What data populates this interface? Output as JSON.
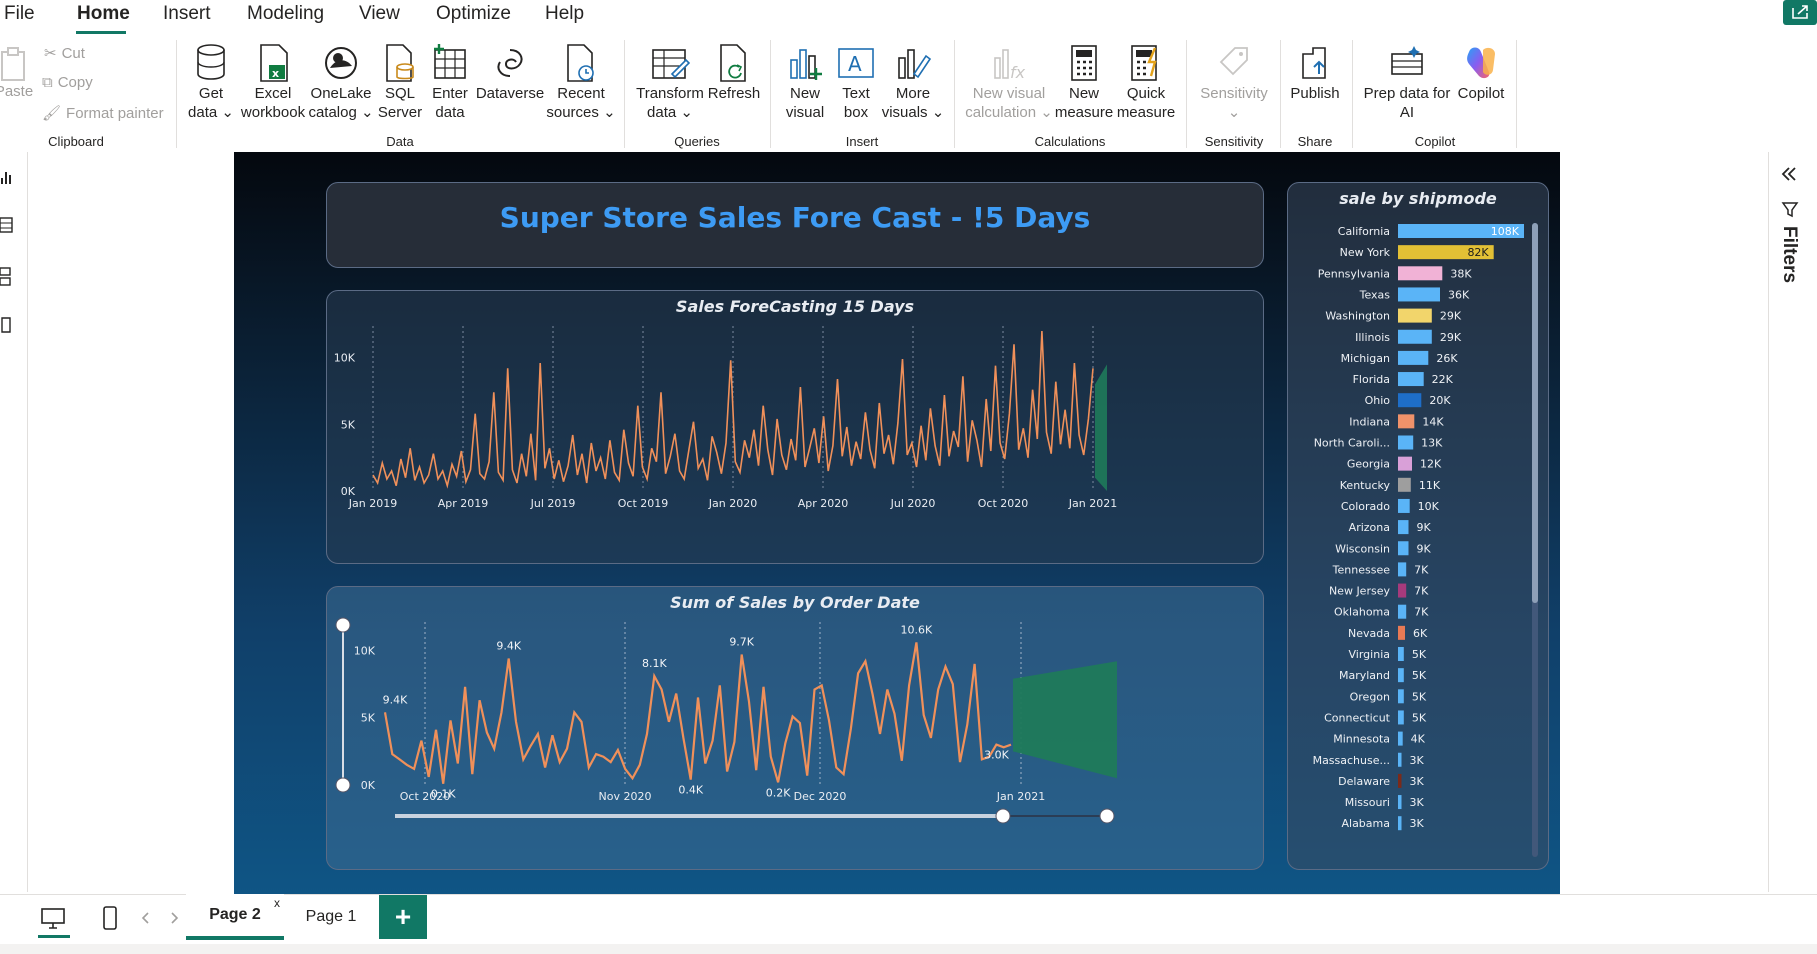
{
  "menu": [
    "File",
    "Home",
    "Insert",
    "Modeling",
    "View",
    "Optimize",
    "Help"
  ],
  "ribbon": {
    "clipboard": {
      "paste": "Paste",
      "cut": "Cut",
      "copy": "Copy",
      "format_painter": "Format painter",
      "label": "Clipboard"
    },
    "data": {
      "label": "Data",
      "buttons": [
        {
          "l1": "Get",
          "l2": "data ⌄"
        },
        {
          "l1": "Excel",
          "l2": "workbook"
        },
        {
          "l1": "OneLake",
          "l2": "catalog ⌄"
        },
        {
          "l1": "SQL",
          "l2": "Server"
        },
        {
          "l1": "Enter",
          "l2": "data"
        },
        {
          "l1": "Dataverse",
          "l2": ""
        },
        {
          "l1": "Recent",
          "l2": "sources ⌄"
        }
      ]
    },
    "queries": {
      "label": "Queries",
      "transform_l1": "Transform",
      "transform_l2": "data ⌄",
      "refresh": "Refresh"
    },
    "insert": {
      "label": "Insert",
      "new_visual_l1": "New",
      "new_visual_l2": "visual",
      "text_box_l1": "Text",
      "text_box_l2": "box",
      "more_visuals_l1": "More",
      "more_visuals_l2": "visuals ⌄"
    },
    "calculations": {
      "label": "Calculations",
      "new_visual_calc_l1": "New visual",
      "new_visual_calc_l2": "calculation ⌄",
      "new_measure_l1": "New",
      "new_measure_l2": "measure",
      "quick_measure_l1": "Quick",
      "quick_measure_l2": "measure"
    },
    "sensitivity": {
      "label": "Sensitivity",
      "button": "Sensitivity",
      "chevron": "⌄"
    },
    "share": {
      "label": "Share",
      "publish": "Publish"
    },
    "copilot": {
      "label": "Copilot",
      "prep_l1": "Prep data for",
      "prep_l2": "AI",
      "copilot": "Copilot"
    }
  },
  "report": {
    "title": "Super Store Sales Fore Cast - !5 Days",
    "forecast_title": "Sales ForeCasting 15 Days",
    "orders_title": "Sum of Sales by Order Date",
    "ship_title": "sale by shipmode"
  },
  "chart_data": [
    {
      "type": "line",
      "title": "Sales ForeCasting 15 Days",
      "x_ticks": [
        "Jan 2019",
        "Apr 2019",
        "Jul 2019",
        "Oct 2019",
        "Jan 2020",
        "Apr 2020",
        "Jul 2020",
        "Oct 2020",
        "Jan 2021"
      ],
      "y_ticks": [
        "0K",
        "5K",
        "10K"
      ],
      "ylim": [
        0,
        12000
      ],
      "series": [
        {
          "values": [
            1200,
            600,
            2100,
            900,
            1500,
            400,
            2400,
            1000,
            3200,
            800,
            1800,
            600,
            1200,
            2800,
            900,
            1500,
            400,
            2000,
            1100,
            3000,
            700,
            1600,
            5800,
            1300,
            900,
            2200,
            7400,
            1400,
            800,
            9200,
            1600,
            600,
            2800,
            1100,
            4300,
            800,
            9600,
            1700,
            3200,
            900,
            2300,
            700,
            1900,
            4200,
            1200,
            2800,
            600,
            3600,
            1500,
            2500,
            900,
            3800,
            1400,
            800,
            4600,
            2100,
            1100,
            6400,
            1800,
            900,
            3200,
            2200,
            7400,
            1300,
            2600,
            4300,
            1500,
            900,
            3100,
            5200,
            1700,
            2400,
            800,
            4100,
            2900,
            1300,
            3600,
            9800,
            2200,
            1400,
            3800,
            2500,
            4600,
            1900,
            6400,
            3100,
            1200,
            5400,
            2700,
            1600,
            3900,
            2300,
            7800,
            1800,
            3200,
            4700,
            2100,
            5600,
            1500,
            3400,
            8400,
            2600,
            4800,
            1900,
            3700,
            2400,
            5900,
            3100,
            1700,
            6600,
            2800,
            4200,
            2000,
            5100,
            9900,
            2700,
            3600,
            1800,
            4900,
            2300,
            6200,
            3400,
            1900,
            7200,
            2600,
            4500,
            3300,
            8600,
            2200,
            5300,
            3800,
            1800,
            6900,
            3000,
            9400,
            3600,
            2400,
            5800,
            11000,
            3100,
            4700,
            2500,
            7600,
            3900,
            12000,
            4400,
            2800,
            8200,
            3500,
            6100,
            3200,
            9600,
            4200,
            2700,
            5400,
            9200
          ]
        }
      ],
      "forecast": {
        "lower": 1000,
        "upper": 9500
      }
    },
    {
      "type": "line",
      "title": "Sum of Sales by Order Date",
      "x_ticks": [
        "Oct 2020",
        "Nov 2020",
        "Dec 2020",
        "Jan 2021"
      ],
      "y_ticks": [
        "0K",
        "5K",
        "10K"
      ],
      "ylim": [
        0,
        11000
      ],
      "data_labels": [
        "9.4K",
        "9.4K",
        "8.1K",
        "9.7K",
        "10.6K",
        "0.1K",
        "0.4K",
        "0.2K",
        "3.0K"
      ],
      "series": [
        {
          "values": [
            5400,
            2300,
            1900,
            1500,
            1200,
            3300,
            600,
            4100,
            100,
            4800,
            1600,
            7300,
            800,
            6300,
            3900,
            2700,
            5400,
            9400,
            4700,
            1900,
            2900,
            3800,
            1300,
            3700,
            1700,
            2700,
            5400,
            4700,
            1300,
            2300,
            2100,
            1700,
            2600,
            1200,
            500,
            1500,
            3800,
            8100,
            7100,
            4700,
            6800,
            3500,
            400,
            6500,
            1600,
            3300,
            7400,
            1000,
            3200,
            9700,
            6200,
            1100,
            7300,
            2100,
            200,
            3100,
            5100,
            4600,
            700,
            7100,
            7400,
            4800,
            1300,
            800,
            4200,
            8300,
            9200,
            6700,
            3800,
            7100,
            5300,
            1800,
            7400,
            10600,
            5200,
            3500,
            7100,
            8800,
            7500,
            1700,
            4500,
            9000,
            1900,
            2100,
            3000,
            2800,
            3000
          ]
        }
      ],
      "forecast": {
        "lower": 500,
        "upper": 9200
      }
    },
    {
      "type": "bar",
      "title": "sale by shipmode",
      "categories": [
        "California",
        "New York",
        "Pennsylvania",
        "Texas",
        "Washington",
        "Illinois",
        "Michigan",
        "Florida",
        "Ohio",
        "Indiana",
        "North Caroli...",
        "Georgia",
        "Kentucky",
        "Colorado",
        "Arizona",
        "Wisconsin",
        "Tennessee",
        "New Jersey",
        "Oklahoma",
        "Nevada",
        "Virginia",
        "Maryland",
        "Oregon",
        "Connecticut",
        "Minnesota",
        "Massachuse...",
        "Delaware",
        "Missouri",
        "Alabama"
      ],
      "values": [
        108,
        82,
        38,
        36,
        29,
        29,
        26,
        22,
        20,
        14,
        13,
        12,
        11,
        10,
        9,
        9,
        7,
        7,
        7,
        6,
        5,
        5,
        5,
        5,
        4,
        3,
        3,
        3,
        3
      ],
      "labels": [
        "108K",
        "82K",
        "38K",
        "36K",
        "29K",
        "29K",
        "26K",
        "22K",
        "20K",
        "14K",
        "13K",
        "12K",
        "11K",
        "10K",
        "9K",
        "9K",
        "7K",
        "7K",
        "7K",
        "6K",
        "5K",
        "5K",
        "5K",
        "5K",
        "4K",
        "3K",
        "3K",
        "3K",
        "3K"
      ],
      "colors": [
        "#5ab4f7",
        "#e2c035",
        "#f1b2d6",
        "#5ab4f7",
        "#f2d56b",
        "#5ab4f7",
        "#5ab4f7",
        "#5ab4f7",
        "#1e6ec8",
        "#f0926a",
        "#5ab4f7",
        "#d9a0d8",
        "#9e9e9e",
        "#5ab4f7",
        "#5ab4f7",
        "#5ab4f7",
        "#5ab4f7",
        "#a63a7c",
        "#5ab4f7",
        "#e87a55",
        "#5ab4f7",
        "#5ab4f7",
        "#5ab4f7",
        "#5ab4f7",
        "#5ab4f7",
        "#5ab4f7",
        "#7a2a1a",
        "#5ab4f7",
        "#5ab4f7"
      ]
    }
  ],
  "colors": {
    "accent": "#117865",
    "line": "#f0905a",
    "forecast": "#1f7a5a",
    "title": "#3d9bf4"
  },
  "side": {
    "filters": "Filters"
  },
  "tabs": {
    "page2": "Page 2",
    "page1": "Page 1",
    "close": "x",
    "add": "+"
  }
}
